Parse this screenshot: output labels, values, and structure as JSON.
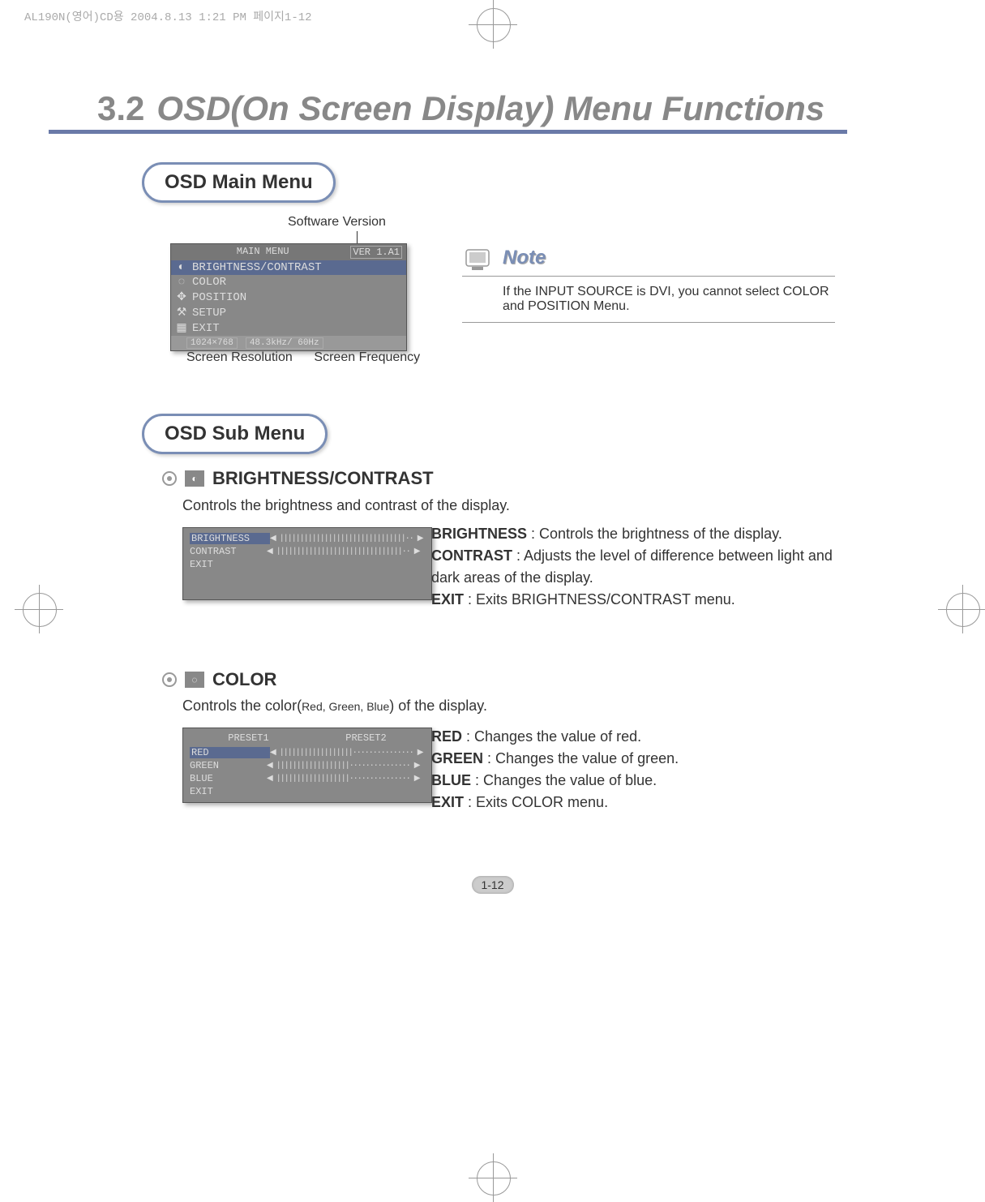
{
  "print_header": "AL190N(영어)CD용 2004.8.13 1:21 PM 페이지1-12",
  "section": {
    "number": "3.2",
    "title": "OSD(On Screen Display) Menu Functions"
  },
  "main_menu_pill": "OSD Main Menu",
  "sub_menu_pill": "OSD Sub Menu",
  "main_screenshot": {
    "software_version_label": "Software Version",
    "title": "MAIN MENU",
    "version": "VER  1.A1",
    "items": [
      "BRIGHTNESS/CONTRAST",
      "COLOR",
      "POSITION",
      "SETUP",
      "EXIT"
    ],
    "resolution": "1024×768",
    "frequency": "48.3kHz/  60Hz",
    "resolution_label": "Screen Resolution",
    "frequency_label": "Screen Frequency"
  },
  "note": {
    "title": "Note",
    "body": "If the INPUT SOURCE is DVI, you cannot select COLOR and POSITION Menu."
  },
  "brightness": {
    "heading": "BRIGHTNESS/CONTRAST",
    "description": "Controls the brightness and contrast of the display.",
    "menu_items": [
      "BRIGHTNESS",
      "CONTRAST",
      "EXIT"
    ],
    "defs": {
      "b_term": "BRIGHTNESS",
      "b_def": " : Controls the brightness of the display.",
      "c_term": "CONTRAST",
      "c_def": " : Adjusts the level of difference between light and dark areas of the display.",
      "e_term": "EXIT",
      "e_def": " : Exits BRIGHTNESS/CONTRAST menu."
    }
  },
  "color": {
    "heading": "COLOR",
    "description_pre": "Controls the color(",
    "description_small": "Red, Green, Blue",
    "description_post": ") of the display.",
    "presets": [
      "PRESET1",
      "PRESET2"
    ],
    "menu_items": [
      "RED",
      "GREEN",
      "BLUE",
      "EXIT"
    ],
    "defs": {
      "r_term": "RED",
      "r_def": " : Changes the value of red.",
      "g_term": "GREEN",
      "g_def": " : Changes the value of green.",
      "b_term": "BLUE",
      "b_def": " : Changes the value of blue.",
      "e_term": "EXIT",
      "e_def": " : Exits COLOR menu."
    }
  },
  "page_number": "1-12"
}
